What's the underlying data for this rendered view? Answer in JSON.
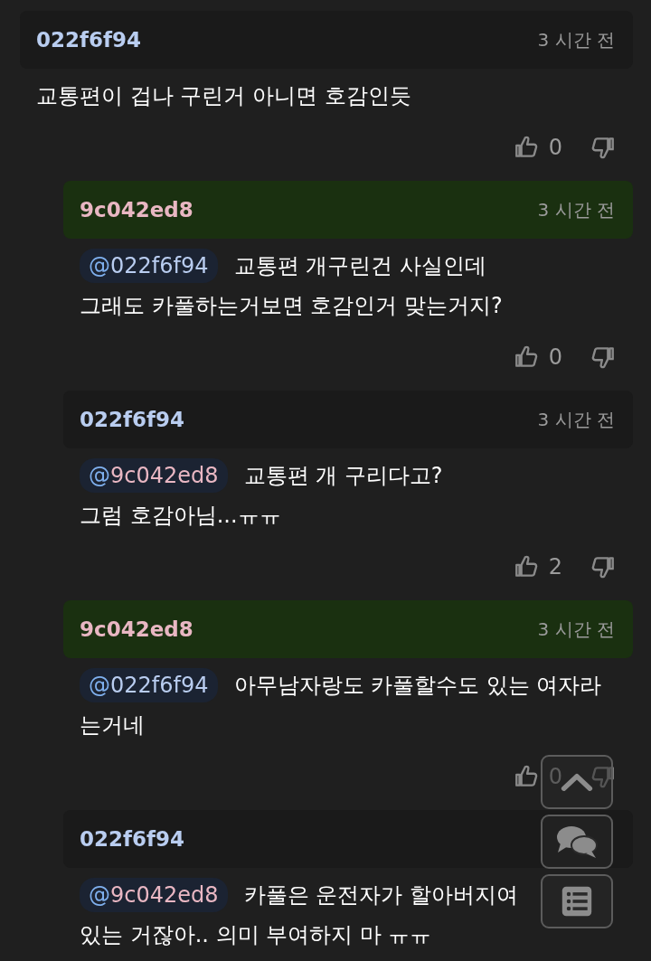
{
  "comments": [
    {
      "author": {
        "name": "022f6f94",
        "color": "#b9cdf0"
      },
      "highlighted": false,
      "time": "3 시간 전",
      "lines": [
        "교통편이 겁나 구린거 아니면 호감인듯"
      ],
      "likes": "0",
      "replies": [
        {
          "author": {
            "name": "9c042ed8",
            "color": "#e9b7c3"
          },
          "highlighted": true,
          "time": "3 시간 전",
          "mention": {
            "at": "@",
            "name": "022f6f94",
            "color": "#b9cdf0"
          },
          "lines": [
            "교통편 개구린건 사실인데",
            "그래도 카풀하는거보면 호감인거 맞는거지?"
          ],
          "likes": "0"
        },
        {
          "author": {
            "name": "022f6f94",
            "color": "#b9cdf0"
          },
          "highlighted": false,
          "time": "3 시간 전",
          "mention": {
            "at": "@",
            "name": "9c042ed8",
            "color": "#e9b7c3"
          },
          "lines": [
            "교통편 개 구리다고?",
            "그럼 호감아님...ㅠㅠ"
          ],
          "likes": "2"
        },
        {
          "author": {
            "name": "9c042ed8",
            "color": "#e9b7c3"
          },
          "highlighted": true,
          "time": "3 시간 전",
          "mention": {
            "at": "@",
            "name": "022f6f94",
            "color": "#b9cdf0"
          },
          "lines": [
            "아무남자랑도 카풀할수도 있는 여자라",
            "는거네"
          ],
          "likes": "0"
        },
        {
          "author": {
            "name": "022f6f94",
            "color": "#b9cdf0"
          },
          "highlighted": false,
          "mention": {
            "at": "@",
            "name": "9c042ed8",
            "color": "#e9b7c3"
          },
          "lines": [
            "카풀은 운전자가 할아버지여",
            "있는 거잖아.. 의미 부여하지 마 ㅠㅠ"
          ]
        }
      ]
    }
  ],
  "floating_buttons": [
    {
      "kind": "up"
    },
    {
      "kind": "chat"
    },
    {
      "kind": "list"
    }
  ]
}
